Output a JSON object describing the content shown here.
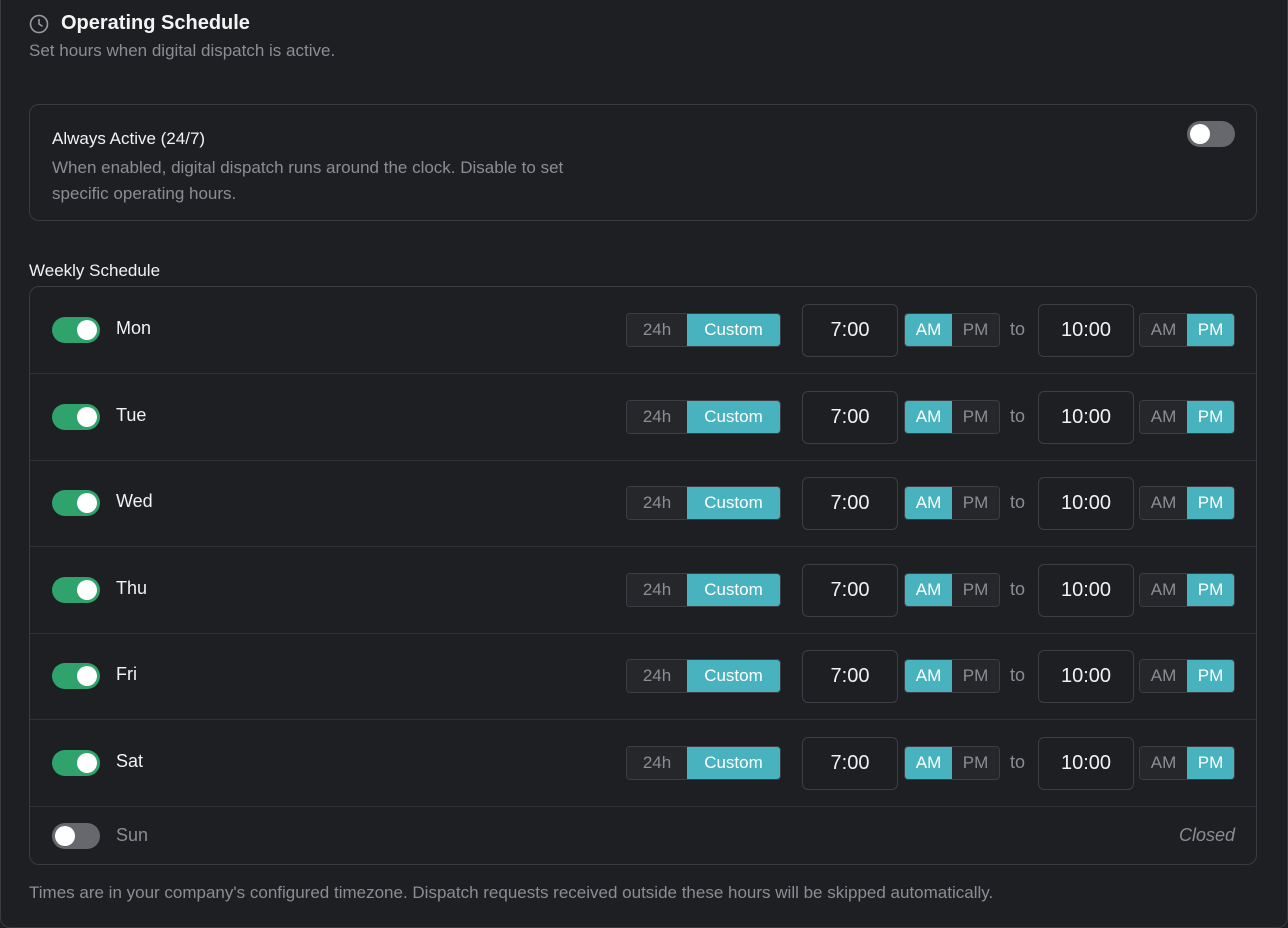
{
  "header": {
    "title": "Operating Schedule",
    "subtitle": "Set hours when digital dispatch is active."
  },
  "always_active": {
    "title": "Always Active (24/7)",
    "description": "When enabled, digital dispatch runs around the clock. Disable to set specific operating hours.",
    "enabled": false
  },
  "weekly": {
    "label": "Weekly Schedule",
    "connector": "to",
    "mode_labels": {
      "h24": "24h",
      "custom": "Custom"
    },
    "ampm_labels": {
      "am": "AM",
      "pm": "PM"
    },
    "closed_label": "Closed",
    "days": [
      {
        "name": "Mon",
        "enabled": true,
        "mode": "Custom",
        "from": "7:00",
        "from_period": "AM",
        "to": "10:00",
        "to_period": "PM"
      },
      {
        "name": "Tue",
        "enabled": true,
        "mode": "Custom",
        "from": "7:00",
        "from_period": "AM",
        "to": "10:00",
        "to_period": "PM"
      },
      {
        "name": "Wed",
        "enabled": true,
        "mode": "Custom",
        "from": "7:00",
        "from_period": "AM",
        "to": "10:00",
        "to_period": "PM"
      },
      {
        "name": "Thu",
        "enabled": true,
        "mode": "Custom",
        "from": "7:00",
        "from_period": "AM",
        "to": "10:00",
        "to_period": "PM"
      },
      {
        "name": "Fri",
        "enabled": true,
        "mode": "Custom",
        "from": "7:00",
        "from_period": "AM",
        "to": "10:00",
        "to_period": "PM"
      },
      {
        "name": "Sat",
        "enabled": true,
        "mode": "Custom",
        "from": "7:00",
        "from_period": "AM",
        "to": "10:00",
        "to_period": "PM"
      },
      {
        "name": "Sun",
        "enabled": false
      }
    ]
  },
  "footer": {
    "note": "Times are in your company's configured timezone. Dispatch requests received outside these hours will be skipped automatically."
  },
  "colors": {
    "accent": "#48b3be",
    "toggle_on": "#2fa36b",
    "toggle_off": "#67686e",
    "background": "#1e1f23"
  },
  "icons": {
    "header": "clock-icon"
  }
}
